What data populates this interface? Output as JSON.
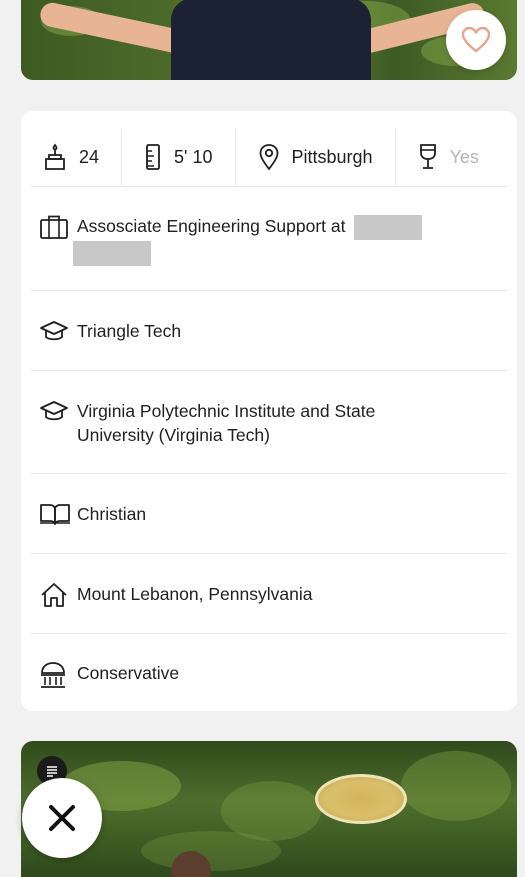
{
  "profile": {
    "stats": [
      {
        "icon": "age-icon",
        "value": "24"
      },
      {
        "icon": "height-icon",
        "value": "5' 10"
      },
      {
        "icon": "location-pin-icon",
        "value": "Pittsburgh"
      },
      {
        "icon": "wine-glass-icon",
        "value": "Yes"
      }
    ],
    "details": [
      {
        "icon": "briefcase-icon",
        "text": "Assosciate Engineering Support at",
        "redacted": true
      },
      {
        "icon": "graduation-cap-icon",
        "text": "Triangle Tech"
      },
      {
        "icon": "graduation-cap-icon",
        "text": "Virginia Polytechnic Institute and State University (Virginia Tech)"
      },
      {
        "icon": "religion-book-icon",
        "text": "Christian"
      },
      {
        "icon": "home-icon",
        "text": "Mount Lebanon, Pennsylvania"
      },
      {
        "icon": "politics-building-icon",
        "text": "Conservative"
      }
    ]
  },
  "buttons": {
    "like_icon": "heart-icon",
    "pass_icon": "close-x-icon"
  },
  "colors": {
    "like_heart": "#e9a48d",
    "card_bg": "#ffffff",
    "page_bg": "#f1f1f1",
    "text": "#1f1f1f",
    "faded_text": "#b5b5b5",
    "redaction": "#c8c8c8"
  }
}
